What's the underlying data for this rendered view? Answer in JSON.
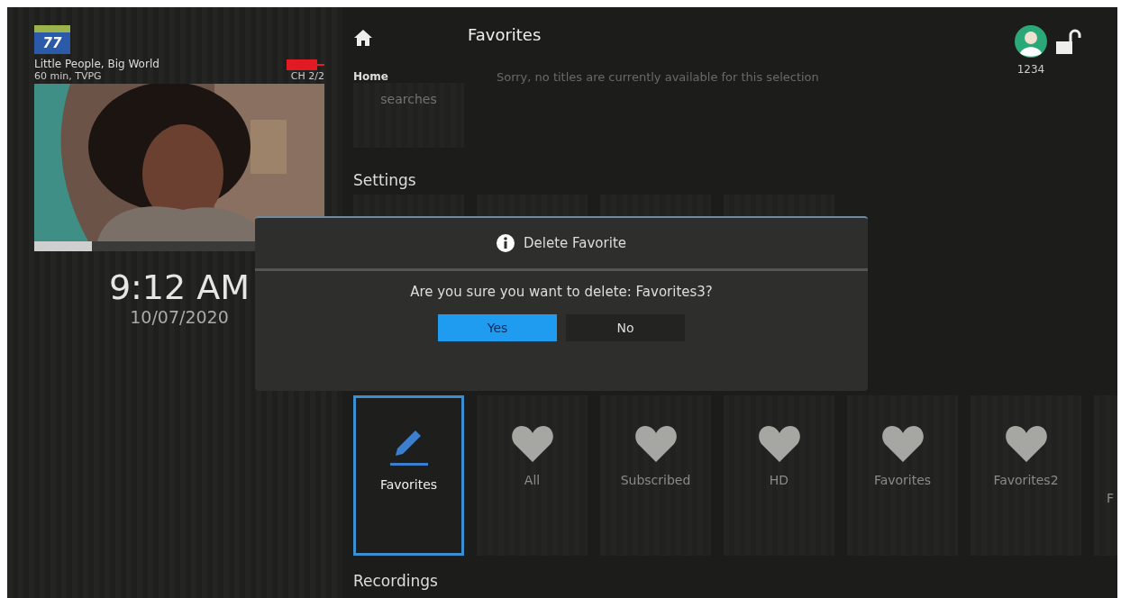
{
  "now_playing": {
    "channel_logo": "77",
    "title": "Little People, Big World",
    "details": "60 min, TVPG",
    "channel": "CH 2/2",
    "recording": true,
    "progress": {
      "level": 0.2
    }
  },
  "clock": {
    "time": "9:12 AM",
    "date": "10/07/2020"
  },
  "nav": {
    "home_label": "Home",
    "title": "Favorites",
    "user": "1234",
    "locked": false
  },
  "empty_message": "Sorry, no titles are currently available for this selection",
  "recent": {
    "label": "searches"
  },
  "sections": [
    {
      "title": "Settings"
    },
    {
      "title": "Recordings"
    }
  ],
  "favorites": [
    {
      "kind": "edit",
      "label": "Favorites",
      "selected": true
    },
    {
      "kind": "heart",
      "label": "All",
      "selected": false
    },
    {
      "kind": "heart",
      "label": "Subscribed",
      "selected": false
    },
    {
      "kind": "heart",
      "label": "HD",
      "selected": false
    },
    {
      "kind": "heart",
      "label": "Favorites",
      "selected": false
    },
    {
      "kind": "heart",
      "label": "Favorites2",
      "selected": false
    },
    {
      "kind": "cut",
      "label": "F",
      "selected": false
    }
  ],
  "dialog": {
    "title": "Delete Favorite",
    "message": "Are you sure you want to delete: Favorites3?",
    "buttons": [
      {
        "label": "Yes",
        "selected": true
      },
      {
        "label": "No",
        "selected": false
      }
    ]
  }
}
